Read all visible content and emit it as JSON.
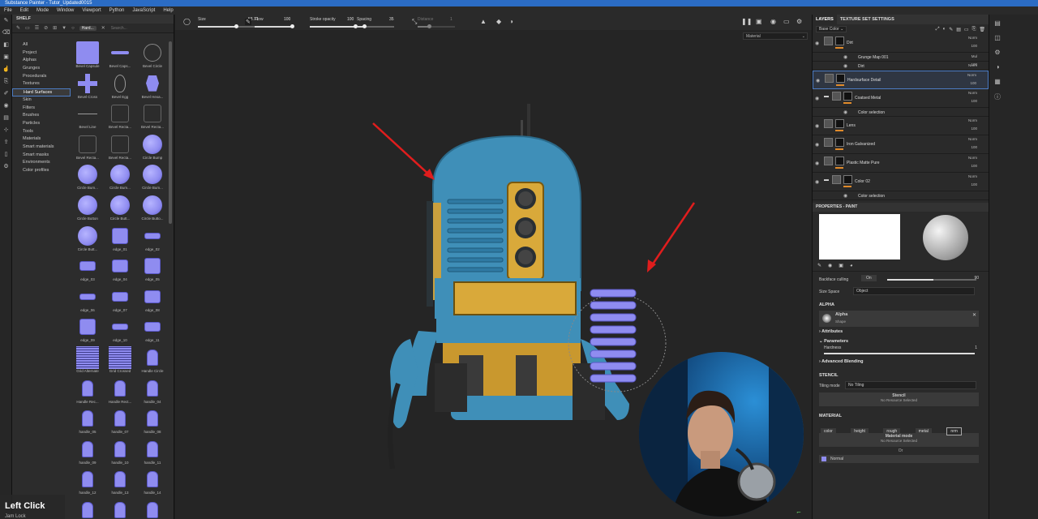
{
  "window": {
    "title": "Substance Painter - Tutor_Updated0015"
  },
  "menu": [
    "File",
    "Edit",
    "Mode",
    "Window",
    "Viewport",
    "Python",
    "JavaScript",
    "Help"
  ],
  "shelf": {
    "title": "SHELF",
    "filter_chip": "Hard...",
    "search_placeholder": "Search...",
    "categories": [
      "All",
      "Project",
      "Alphas",
      "Grunges",
      "Procedurals",
      "Textures",
      "Hard Surfaces",
      "Skin",
      "Filters",
      "Brushes",
      "Particles",
      "Tools",
      "Materials",
      "Smart materials",
      "Smart masks",
      "Environments",
      "Color profiles"
    ],
    "selected_category": "Hard Surfaces",
    "items": [
      "Bevel Capsule",
      "Bevel Caps...",
      "Bevel Circle",
      "Bevel Cross",
      "Bevel Egg",
      "Bevel Hexa...",
      "Bevel Line",
      "Bevel Recta...",
      "Bevel Recta...",
      "Bevel Recta...",
      "Bevel Recta...",
      "Circle Bump",
      "Circle Bum...",
      "Circle Bum...",
      "Circle Bum...",
      "Circle Button",
      "Circle Butt...",
      "Circle Butto...",
      "Circle Butt...",
      "edge_01",
      "edge_02",
      "edge_03",
      "edge_04",
      "edge_05",
      "edge_06",
      "edge_07",
      "edge_08",
      "edge_09",
      "edge_10",
      "edge_11",
      "Grid Alternate",
      "Grid Crossed",
      "Handle Circle",
      "Handle Rec...",
      "Handle Rect...",
      "handle_04",
      "handle_05",
      "handle_07",
      "handle_08",
      "handle_09",
      "handle_10",
      "handle_11",
      "handle_12",
      "handle_13",
      "handle_14",
      "",
      "",
      ""
    ]
  },
  "toolbar": {
    "size_label": "Size",
    "size_value": "58.71",
    "size_pct": 0.62,
    "flow_label": "Flow",
    "flow_value": "100",
    "flow_pct": 1.0,
    "stroke_opacity_label": "Stroke opacity",
    "stroke_opacity_value": "100",
    "stroke_opacity_pct": 1.0,
    "spacing_label": "Spacing",
    "spacing_value": "35",
    "spacing_pct": 0.2,
    "distance_label": "Distance",
    "distance_value": "1",
    "distance_pct": 0.3
  },
  "viewport": {
    "material_select": "Material"
  },
  "layers_panel": {
    "tab_layers": "LAYERS",
    "tab_texture_set": "TEXTURE SET SETTINGS",
    "channel_select": "Base Color",
    "layers": [
      {
        "name": "Dirt",
        "blend": "Norm",
        "opacity": "100",
        "kind": "layer",
        "highlight": false
      },
      {
        "name": "Grunge Map 001",
        "blend": "Mul",
        "opacity": "100",
        "kind": "sub",
        "highlight": false
      },
      {
        "name": "Dirt",
        "blend": "Norm",
        "opacity": "100",
        "kind": "sub",
        "highlight": false
      },
      {
        "name": "Hardsurface Detail",
        "blend": "Norm",
        "opacity": "100",
        "kind": "layer",
        "highlight": true
      },
      {
        "name": "Coatsed Metal",
        "blend": "Norm",
        "opacity": "100",
        "kind": "folder",
        "highlight": false
      },
      {
        "name": "Color selection",
        "blend": "",
        "opacity": "",
        "kind": "sub",
        "highlight": false
      },
      {
        "name": "Lens",
        "blend": "Norm",
        "opacity": "100",
        "kind": "layer",
        "highlight": false
      },
      {
        "name": "Iron Galvanized",
        "blend": "Norm",
        "opacity": "100",
        "kind": "layer",
        "highlight": false
      },
      {
        "name": "Plastic Matte Pure",
        "blend": "Norm",
        "opacity": "100",
        "kind": "layer",
        "highlight": false
      },
      {
        "name": "Color 02",
        "blend": "Norm",
        "opacity": "100",
        "kind": "folder",
        "highlight": false
      },
      {
        "name": "Color selection",
        "blend": "",
        "opacity": "",
        "kind": "sub",
        "highlight": false
      }
    ]
  },
  "properties": {
    "title": "PROPERTIES - PAINT",
    "backface_label": "Backface culling",
    "backface_value": "On",
    "backface_num": "90",
    "size_space_label": "Size Space",
    "size_space_value": "Object",
    "alpha_section": "ALPHA",
    "alpha_name": "Alpha",
    "alpha_sub": "Shape",
    "attributes": "Attributes",
    "parameters": "Parameters",
    "hardness_label": "Hardness",
    "hardness_value": "1",
    "advanced_blending": "Advanced Blending",
    "stencil_section": "STENCIL",
    "tiling_label": "Tiling mode",
    "tiling_value": "No Tiling",
    "stencil_box": "Stencil",
    "stencil_none": "No Resource Selected",
    "material_section": "MATERIAL",
    "channels": [
      "color",
      "height",
      "rough",
      "metal",
      "nrm"
    ],
    "material_mode": "Material mode",
    "material_none": "No Resource Selected",
    "or_label": "Or",
    "normal_label": "Normal"
  },
  "overlay": {
    "action": "Left Click",
    "sub": "Jam Lock"
  },
  "colors": {
    "accent": "#4d7dc4",
    "arrow": "#e01d1d",
    "robot_blue": "#3f8fb8",
    "robot_yellow": "#d9a93a",
    "stamp": "#8f8cf0"
  }
}
